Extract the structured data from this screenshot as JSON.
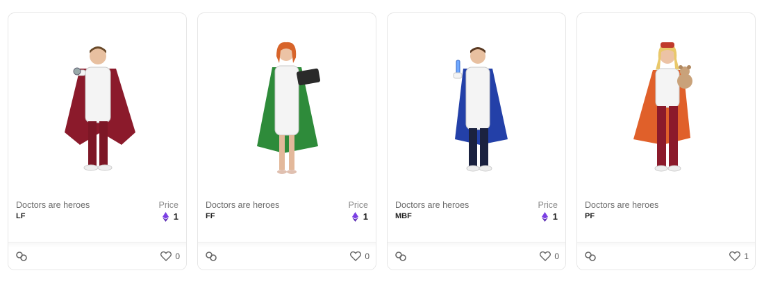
{
  "cards": [
    {
      "collection": "Doctors are heroes",
      "name": "LF",
      "price_label": "Price",
      "price": "1",
      "likes": "0",
      "cape_color": "#8b1a2b",
      "figure": "male-doctor-stethoscope"
    },
    {
      "collection": "Doctors are heroes",
      "name": "FF",
      "price_label": "Price",
      "price": "1",
      "likes": "0",
      "cape_color": "#2e8b3a",
      "figure": "female-doctor-tablet"
    },
    {
      "collection": "Doctors are heroes",
      "name": "MBF",
      "price_label": "Price",
      "price": "1",
      "likes": "0",
      "cape_color": "#2340a8",
      "figure": "male-scientist-testtube"
    },
    {
      "collection": "Doctors are heroes",
      "name": "PF",
      "price_label": "",
      "price": "",
      "likes": "1",
      "cape_color": "#e0602a",
      "figure": "female-nurse-teddybear"
    }
  ],
  "icons": {
    "currency": "ethereum-icon",
    "link": "chain-link-icon",
    "like": "heart-icon"
  },
  "colors": {
    "eth": "#7b3fe4",
    "border": "#e6e6e6"
  }
}
